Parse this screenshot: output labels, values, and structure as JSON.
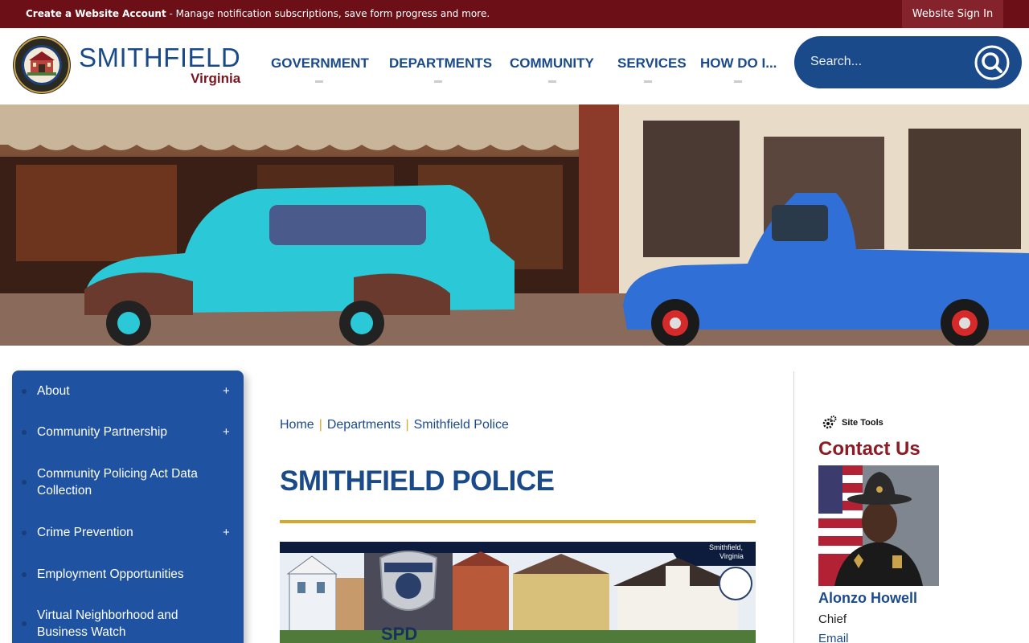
{
  "topbar": {
    "create_account_bold": "Create a Website Account",
    "create_account_rest": " - Manage notification subscriptions, save form progress and more.",
    "sign_in": "Website Sign In"
  },
  "logo": {
    "city": "SMITHFIELD",
    "state": "Virginia"
  },
  "nav": {
    "items": [
      {
        "label": "GOVERNMENT"
      },
      {
        "label": "DEPARTMENTS"
      },
      {
        "label": "COMMUNITY"
      },
      {
        "label": "SERVICES"
      },
      {
        "label": "HOW DO I..."
      }
    ]
  },
  "search": {
    "placeholder": "Search..."
  },
  "sidebar": {
    "items": [
      {
        "label": "About",
        "expandable": true
      },
      {
        "label": "Community Partnership",
        "expandable": true
      },
      {
        "label": "Community Policing Act Data Collection",
        "expandable": false
      },
      {
        "label": "Crime Prevention",
        "expandable": true
      },
      {
        "label": "Employment Opportunities",
        "expandable": false
      },
      {
        "label": "Virtual Neighborhood and Business Watch",
        "expandable": false
      }
    ],
    "expand_symbol": "+"
  },
  "breadcrumb": {
    "items": [
      "Home",
      "Departments",
      "Smithfield Police"
    ],
    "separator": "|"
  },
  "main": {
    "title": "SMITHFIELD POLICE",
    "banner_corner_text_1": "Smithfield,",
    "banner_corner_text_2": "Virginia",
    "banner_badge_text": "SPD"
  },
  "right": {
    "site_tools": "Site Tools",
    "contact_title": "Contact Us",
    "chief_name": "Alonzo Howell",
    "chief_title": "Chief",
    "chief_email": "Email"
  },
  "colors": {
    "topbar": "#6d0f17",
    "brand_blue": "#1b4a8b",
    "sidebar_blue": "#1f53a1",
    "accent_gold": "#d4a82c",
    "contact_red": "#8c1b24"
  }
}
